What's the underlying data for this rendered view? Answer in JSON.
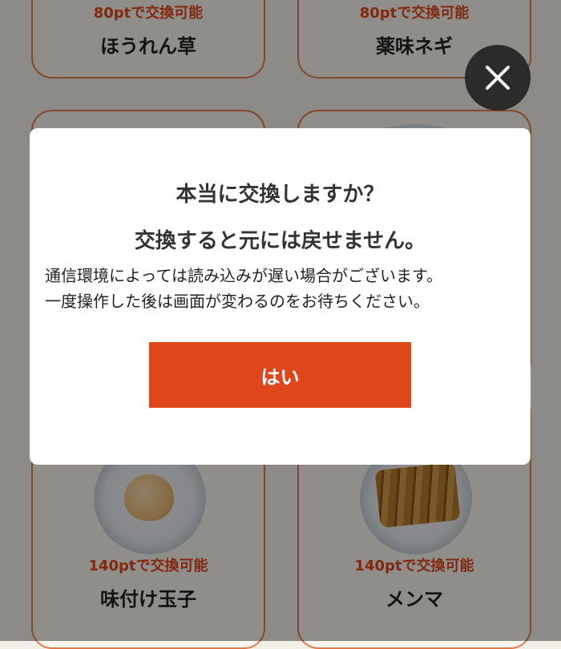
{
  "items": [
    {
      "points": "80ptで交換可能",
      "name": "ほうれん草"
    },
    {
      "points": "80ptで交換可能",
      "name": "薬味ネギ"
    },
    {
      "points": "140ptで交換可能",
      "name": "味付け玉子"
    },
    {
      "points": "140ptで交換可能",
      "name": "メンマ"
    }
  ],
  "close_icon": "close-icon",
  "dialog": {
    "title": "本当に交換しますか？",
    "subtitle": "交換すると元には戻せません。",
    "body_line1": "通信環境によっては読み込みが遅い場合がございます。",
    "body_line2": "一度操作した後は画面が変わるのをお待ちください。",
    "confirm_label": "はい"
  },
  "colors": {
    "accent": "#e0461b",
    "card_border": "#e07a4c",
    "overlay": "rgba(0,0,0,0.42)"
  }
}
